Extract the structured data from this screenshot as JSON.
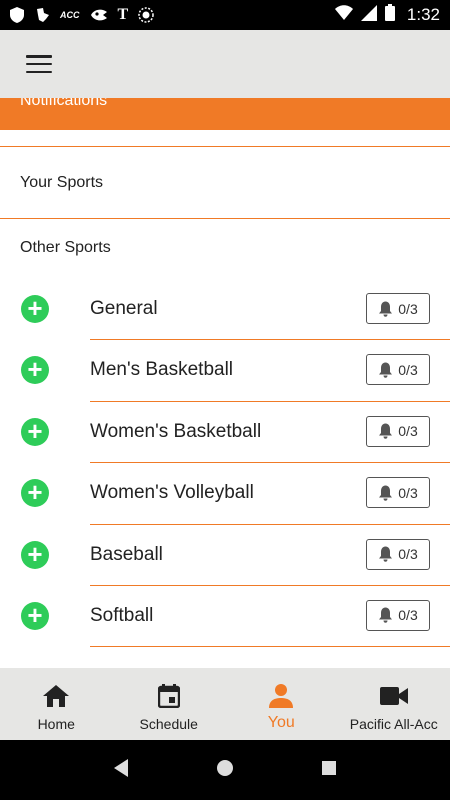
{
  "status_bar": {
    "time": "1:32",
    "left_icons": [
      "shield-icon",
      "bird-icon",
      "acc-logo-icon",
      "hawkeye-icon",
      "t-logo-icon",
      "circle-logo-icon"
    ],
    "acc_text": "ACC",
    "t_text": "T"
  },
  "header": {
    "menu_icon": "hamburger-menu-icon"
  },
  "notifications": {
    "label": "Notifications"
  },
  "sections": {
    "your_sports": "Your Sports",
    "other_sports": "Other Sports"
  },
  "sports": [
    {
      "name": "General",
      "count": "0/3"
    },
    {
      "name": "Men's Basketball",
      "count": "0/3"
    },
    {
      "name": "Women's Basketball",
      "count": "0/3"
    },
    {
      "name": "Women's Volleyball",
      "count": "0/3"
    },
    {
      "name": "Baseball",
      "count": "0/3"
    },
    {
      "name": "Softball",
      "count": "0/3"
    }
  ],
  "bottom_nav": [
    {
      "label": "Home",
      "icon": "home-icon",
      "active": false
    },
    {
      "label": "Schedule",
      "icon": "calendar-icon",
      "active": false
    },
    {
      "label": "You",
      "icon": "person-icon",
      "active": true
    },
    {
      "label": "Pacific All-Acc",
      "icon": "video-camera-icon",
      "active": false
    }
  ],
  "colors": {
    "accent": "#f07a26",
    "add_green": "#2ecc59",
    "bar_bg": "#e6e6e4"
  }
}
